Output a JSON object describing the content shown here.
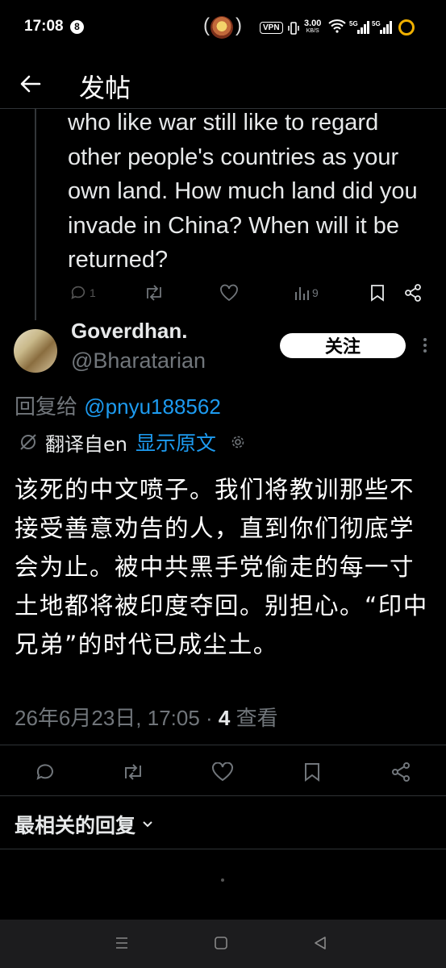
{
  "status_bar": {
    "time": "17:08",
    "notification_count": "8",
    "vpn": "VPN",
    "speed_value": "3.00",
    "speed_unit": "KB/S",
    "network_1": "5G",
    "network_2": "5G"
  },
  "header": {
    "title": "发帖"
  },
  "parent_tweet": {
    "text": "who like war still like to regard other people's countries as your own land. How much land did you invade in China? When will it be returned?",
    "replies": "1",
    "views": "9"
  },
  "tweet": {
    "author_name": "Goverdhan.",
    "author_handle": "@Bharatarian",
    "follow_label": "关注",
    "reply_prefix": "回复给",
    "reply_handle": "@pnyu188562",
    "translated_from": "翻译自en",
    "show_original": "显示原文",
    "text": "该死的中文喷子。我们将教训那些不接受善意劝告的人，直到你们彻底学会为止。被中共黑手党偷走的每一寸土地都将被印度夺回。别担心。“印中兄弟”的时代已成尘土。",
    "timestamp": "26年6月23日, 17:05 · ",
    "view_count": "4",
    "view_label": " 查看"
  },
  "replies_section": {
    "sort_label": "最相关的回复"
  },
  "colors": {
    "accent": "#1d9bf0",
    "muted": "#71767b",
    "background": "#000000"
  }
}
